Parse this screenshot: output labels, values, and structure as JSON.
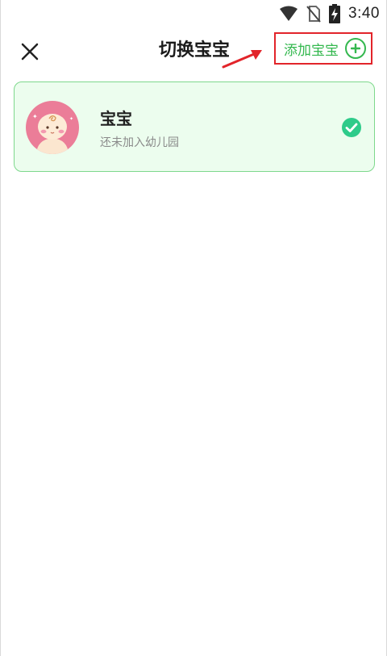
{
  "status_bar": {
    "time": "3:40",
    "icons": [
      "wifi-icon",
      "no-sim-icon",
      "battery-charging-icon"
    ]
  },
  "header": {
    "title": "切换宝宝",
    "close_icon": "close-icon",
    "add_button_label": "添加宝宝",
    "add_icon": "plus-circle-icon"
  },
  "babies": [
    {
      "name": "宝宝",
      "status": "还未加入幼儿园",
      "selected": true
    }
  ],
  "colors": {
    "accent_green": "#34b84f",
    "card_bg": "#ecfdee",
    "card_border": "#7ed88c",
    "highlight_red": "#e2242a",
    "avatar_bg": "#eb7d98"
  }
}
